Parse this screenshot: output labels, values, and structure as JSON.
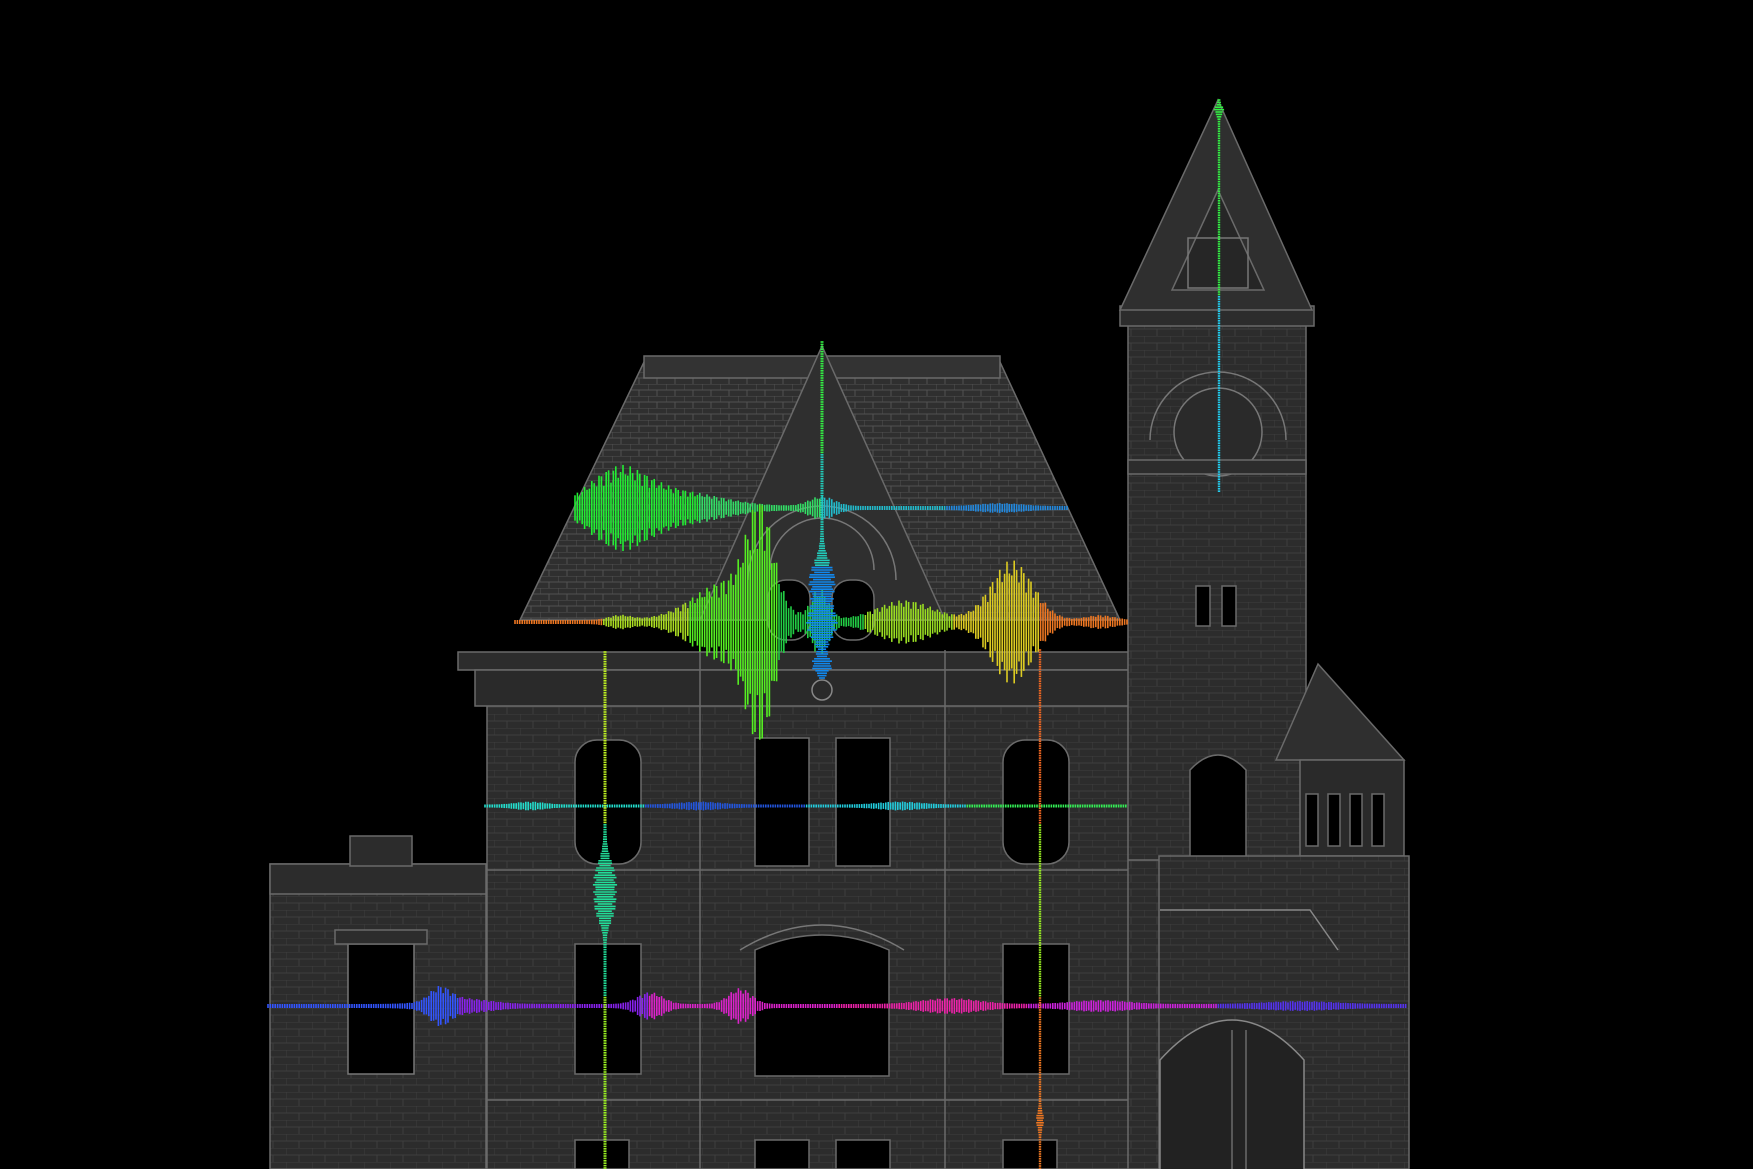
{
  "scene": {
    "background": "#000000",
    "building_fill": "#2c2c2c",
    "building_line": "#6a6a6a",
    "window_fill": "#000000"
  },
  "waveforms": [
    {
      "id": "roof-horizontal",
      "colors": [
        "#22ee33",
        "#33dd66",
        "#22bbcc",
        "#2288dd"
      ]
    },
    {
      "id": "dormer-horizontal",
      "colors": [
        "#ee7722",
        "#aadd22",
        "#55ee22",
        "#22cc44",
        "#99dd22",
        "#ddcc22",
        "#ee7722"
      ]
    },
    {
      "id": "upper-floor-horizontal",
      "colors": [
        "#22ddcc",
        "#2255dd",
        "#22ccdd",
        "#33ee55"
      ]
    },
    {
      "id": "ground-floor-horizontal",
      "colors": [
        "#3355ff",
        "#8822ee",
        "#dd22cc",
        "#ee22aa",
        "#cc22dd",
        "#5533ee"
      ]
    },
    {
      "id": "gable-vertical",
      "colors": [
        "#33ee44",
        "#22ccbb",
        "#1188ee"
      ]
    },
    {
      "id": "tower-vertical",
      "colors": [
        "#33ee44",
        "#22ccee"
      ]
    },
    {
      "id": "left-vertical",
      "colors": [
        "#bbee22",
        "#22dd99",
        "#99ee22"
      ]
    },
    {
      "id": "right-vertical",
      "colors": [
        "#ee6622",
        "#99ee22",
        "#ee7722"
      ]
    }
  ]
}
